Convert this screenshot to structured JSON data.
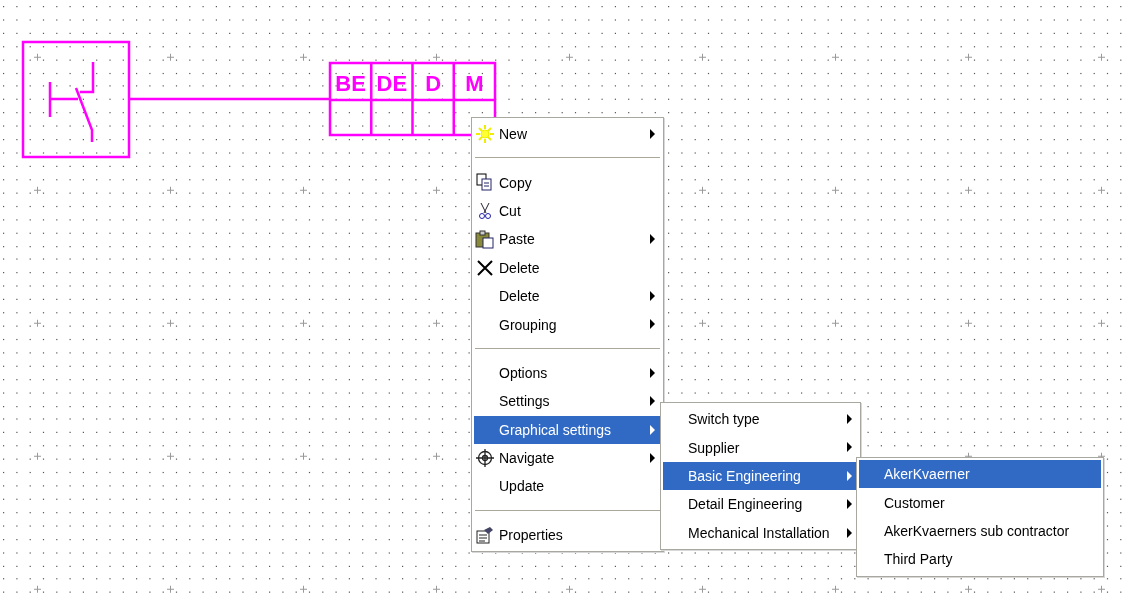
{
  "diagram": {
    "table_headers": [
      "BE",
      "DE",
      "D",
      "M"
    ]
  },
  "context_menu": {
    "items": [
      {
        "kind": "item",
        "label": "New",
        "has_submenu": true,
        "selected": false
      },
      {
        "kind": "separator"
      },
      {
        "kind": "item",
        "label": "Copy",
        "has_submenu": false,
        "selected": false
      },
      {
        "kind": "item",
        "label": "Cut",
        "has_submenu": false,
        "selected": false
      },
      {
        "kind": "item",
        "label": "Paste",
        "has_submenu": true,
        "selected": false
      },
      {
        "kind": "item",
        "label": "Delete",
        "has_submenu": false,
        "selected": false
      },
      {
        "kind": "item",
        "label": "Delete",
        "has_submenu": true,
        "selected": false
      },
      {
        "kind": "item",
        "label": "Grouping",
        "has_submenu": true,
        "selected": false
      },
      {
        "kind": "separator"
      },
      {
        "kind": "item",
        "label": "Options",
        "has_submenu": true,
        "selected": false
      },
      {
        "kind": "item",
        "label": "Settings",
        "has_submenu": true,
        "selected": false
      },
      {
        "kind": "item",
        "label": "Graphical settings",
        "has_submenu": true,
        "selected": true,
        "submenu": [
          {
            "kind": "item",
            "label": "Switch type",
            "has_submenu": true,
            "selected": false
          },
          {
            "kind": "item",
            "label": "Supplier",
            "has_submenu": true,
            "selected": false
          },
          {
            "kind": "item",
            "label": "Basic Engineering",
            "has_submenu": true,
            "selected": true,
            "submenu": [
              {
                "kind": "item",
                "label": "AkerKvaerner",
                "has_submenu": false,
                "selected": true
              },
              {
                "kind": "item",
                "label": "Customer",
                "has_submenu": false,
                "selected": false
              },
              {
                "kind": "item",
                "label": "AkerKvaerners sub contractor",
                "has_submenu": false,
                "selected": false
              },
              {
                "kind": "item",
                "label": "Third Party",
                "has_submenu": false,
                "selected": false
              }
            ]
          },
          {
            "kind": "item",
            "label": "Detail Engineering",
            "has_submenu": true,
            "selected": false
          },
          {
            "kind": "item",
            "label": "Mechanical Installation",
            "has_submenu": true,
            "selected": false
          }
        ]
      },
      {
        "kind": "item",
        "label": "Navigate",
        "has_submenu": true,
        "selected": false
      },
      {
        "kind": "item",
        "label": "Update",
        "has_submenu": false,
        "selected": false
      },
      {
        "kind": "separator"
      },
      {
        "kind": "item",
        "label": "Properties",
        "has_submenu": false,
        "selected": false
      }
    ]
  }
}
